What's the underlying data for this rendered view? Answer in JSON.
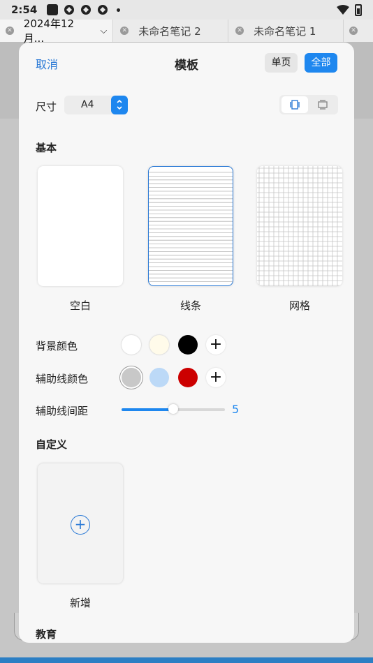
{
  "status": {
    "time": "2:54"
  },
  "tabs": [
    {
      "label": "2024年12月..."
    },
    {
      "label": "未命名笔记 2"
    },
    {
      "label": "未命名笔记 1"
    }
  ],
  "dialog": {
    "cancel": "取消",
    "title": "模板",
    "single_page": "单页",
    "all": "全部",
    "size_label": "尺寸",
    "size_value": "A4",
    "basic_section": "基本",
    "templates": [
      {
        "label": "空白"
      },
      {
        "label": "线条"
      },
      {
        "label": "网格"
      }
    ],
    "bg_color_label": "背景颜色",
    "bg_colors": [
      "#ffffff",
      "#fffbea",
      "#000000"
    ],
    "guide_color_label": "辅助线颜色",
    "guide_colors": [
      "#c8c8c8",
      "#bcd9f7",
      "#cc0000"
    ],
    "spacing_label": "辅助线间距",
    "spacing_value": "5",
    "spacing_fraction": 0.5,
    "custom_section": "自定义",
    "new_label": "新增",
    "education_section": "教育"
  },
  "colors": {
    "accent": "#1e87ef"
  }
}
